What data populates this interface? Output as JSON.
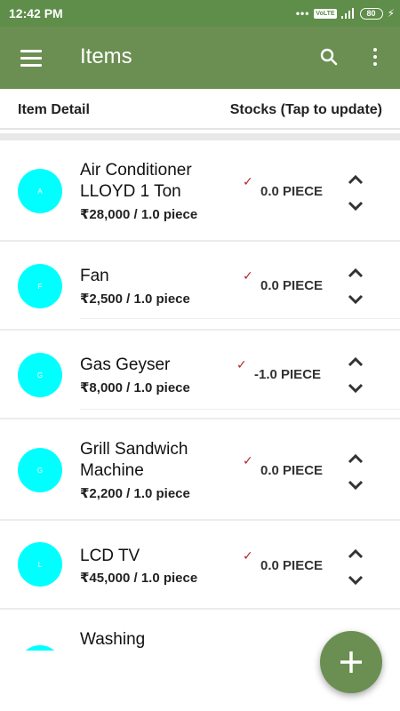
{
  "status_bar": {
    "time": "12:42 PM",
    "dots": "•••",
    "volte": "VoLTE",
    "battery": "80"
  },
  "app_bar": {
    "title": "Items",
    "icons": [
      "menu-icon",
      "search-icon",
      "more-vert-icon"
    ]
  },
  "list_header": {
    "left": "Item Detail",
    "right": "Stocks (Tap to update)"
  },
  "items": [
    {
      "initial": "A",
      "name": "Air Conditioner LLOYD 1 Ton",
      "price": "₹28,000 / 1.0 piece",
      "stock": "0.0 PIECE"
    },
    {
      "initial": "F",
      "name": "Fan",
      "price": "₹2,500 / 1.0 piece",
      "stock": "0.0 PIECE"
    },
    {
      "initial": "G",
      "name": "Gas Geyser",
      "price": "₹8,000 / 1.0 piece",
      "stock": "-1.0 PIECE"
    },
    {
      "initial": "G",
      "name": "Grill Sandwich Machine",
      "price": "₹2,200 / 1.0 piece",
      "stock": "0.0 PIECE"
    },
    {
      "initial": "L",
      "name": "LCD TV",
      "price": "₹45,000 / 1.0 piece",
      "stock": "0.0 PIECE"
    },
    {
      "initial": "",
      "name": "Washing",
      "price": "",
      "stock": ""
    }
  ],
  "check_mark": "✓",
  "fab": {
    "icon": "add-icon"
  },
  "colors": {
    "status_bar": "#5f8d4a",
    "app_bar": "#6b8f52",
    "avatar": "#00ffff",
    "check": "#b32626"
  }
}
